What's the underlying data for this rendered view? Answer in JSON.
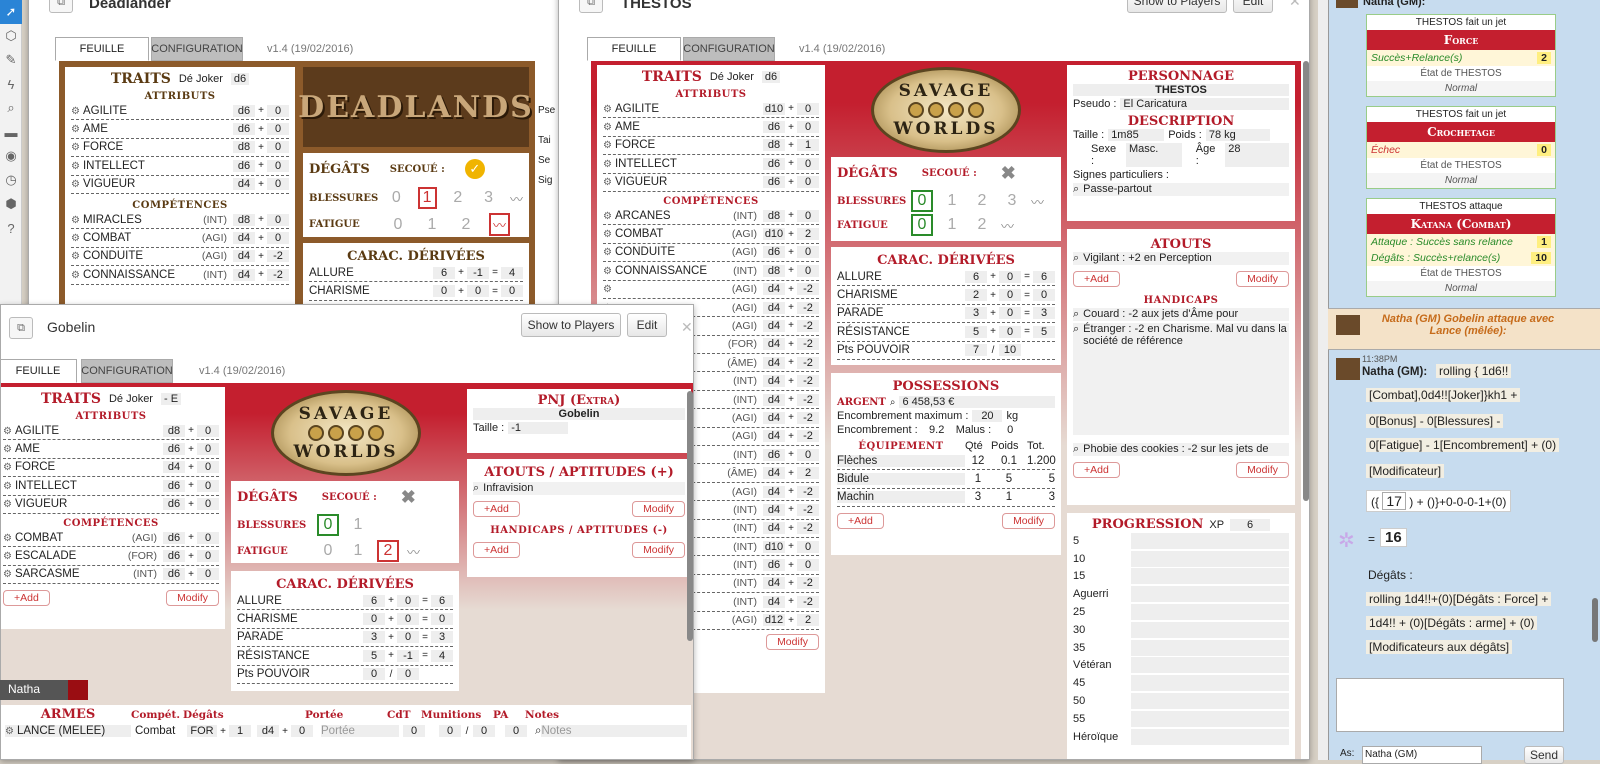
{
  "toolbar": {
    "icons": [
      "select-icon",
      "cube-icon",
      "brush-icon",
      "lightning-icon",
      "zoom-icon",
      "ruler-icon",
      "eye-icon",
      "clock-icon",
      "dice-icon",
      "help-icon"
    ]
  },
  "deadlands": {
    "title": "Deadlander",
    "tab1": "FEUILLE",
    "tab2": "CONFIGURATION",
    "version": "v1.4 (19/02/2016)",
    "logo": "DEADLANDS",
    "traits": "TRAITS",
    "joker_label": "Dé Joker",
    "joker": "d6",
    "attrs_h": "ATTRIBUTS",
    "attrs": [
      {
        "n": "AGILITÉ",
        "d": "d6",
        "m": "0"
      },
      {
        "n": "ÂME",
        "d": "d6",
        "m": "0"
      },
      {
        "n": "FORCE",
        "d": "d8",
        "m": "0"
      },
      {
        "n": "INTELLECT",
        "d": "d6",
        "m": "0"
      },
      {
        "n": "VIGUEUR",
        "d": "d4",
        "m": "0"
      }
    ],
    "comp_h": "COMPÉTENCES",
    "comps": [
      {
        "n": "MIRACLES",
        "t": "(INT)",
        "d": "d8",
        "m": "0"
      },
      {
        "n": "COMBAT",
        "t": "(AGI)",
        "d": "d4",
        "m": "0"
      },
      {
        "n": "CONDUITE",
        "t": "(AGI)",
        "d": "d4",
        "m": "-2"
      },
      {
        "n": "CONNAISSANCE",
        "t": "(INT)",
        "d": "d4",
        "m": "-2"
      }
    ],
    "degats": "DÉGÂTS",
    "secoue": "SECOUÉ :",
    "blessures": "BLESSURES",
    "fatigue": "FATIGUE",
    "bl": [
      "0",
      "1",
      "2",
      "3"
    ],
    "fa": [
      "0",
      "1",
      "2"
    ],
    "carac_h": "CARAC. DÉRIVÉES",
    "c1": {
      "n": "ALLURE",
      "a": "6",
      "b": "-1",
      "r": "4"
    },
    "c2": {
      "n": "CHARISME",
      "a": "0",
      "b": "0",
      "r": "0"
    },
    "side": [
      "Pse",
      "Tai",
      "Se",
      "Sig"
    ]
  },
  "thestos": {
    "title": "THESTOS",
    "show": "Show to Players",
    "edit": "Edit",
    "tab1": "FEUILLE",
    "tab2": "CONFIGURATION",
    "version": "v1.4 (19/02/2016)",
    "traits": "TRAITS",
    "joker_label": "Dé Joker",
    "joker": "d6",
    "attrs_h": "ATTRIBUTS",
    "attrs": [
      {
        "n": "AGILITÉ",
        "d": "d10",
        "m": "0"
      },
      {
        "n": "ÂME",
        "d": "d6",
        "m": "0"
      },
      {
        "n": "FORCE",
        "d": "d8",
        "m": "1"
      },
      {
        "n": "INTELLECT",
        "d": "d6",
        "m": "0"
      },
      {
        "n": "VIGUEUR",
        "d": "d6",
        "m": "0"
      }
    ],
    "comp_h": "COMPÉTENCES",
    "comps": [
      {
        "n": "ARCANES",
        "t": "(INT)",
        "d": "d8",
        "m": "0"
      },
      {
        "n": "COMBAT",
        "t": "(AGI)",
        "d": "d10",
        "m": "2"
      },
      {
        "n": "CONDUITE",
        "t": "(AGI)",
        "d": "d6",
        "m": "0"
      },
      {
        "n": "CONNAISSANCE",
        "t": "(INT)",
        "d": "d8",
        "m": "0"
      },
      {
        "n": "",
        "t": "(AGI)",
        "d": "d4",
        "m": "-2"
      },
      {
        "n": "",
        "t": "(AGI)",
        "d": "d4",
        "m": "-2"
      },
      {
        "n": "",
        "t": "(AGI)",
        "d": "d4",
        "m": "-2"
      },
      {
        "n": "",
        "t": "(FOR)",
        "d": "d4",
        "m": "-2"
      },
      {
        "n": "",
        "t": "(ÂME)",
        "d": "d4",
        "m": "-2"
      },
      {
        "n": "",
        "t": "(INT)",
        "d": "d4",
        "m": "-2"
      },
      {
        "n": "",
        "t": "(INT)",
        "d": "d4",
        "m": "-2"
      },
      {
        "n": "",
        "t": "(AGI)",
        "d": "d4",
        "m": "-2"
      },
      {
        "n": "",
        "t": "(AGI)",
        "d": "d4",
        "m": "-2"
      },
      {
        "n": "",
        "t": "(INT)",
        "d": "d6",
        "m": "0"
      },
      {
        "n": "",
        "t": "(ÂME)",
        "d": "d4",
        "m": "2"
      },
      {
        "n": "",
        "t": "(AGI)",
        "d": "d4",
        "m": "-2"
      },
      {
        "n": "",
        "t": "(INT)",
        "d": "d4",
        "m": "-2"
      },
      {
        "n": "",
        "t": "(INT)",
        "d": "d4",
        "m": "-2"
      },
      {
        "n": "",
        "t": "(INT)",
        "d": "d10",
        "m": "0"
      },
      {
        "n": "",
        "t": "(INT)",
        "d": "d6",
        "m": "0"
      },
      {
        "n": "",
        "t": "(INT)",
        "d": "d4",
        "m": "-2"
      },
      {
        "n": "",
        "t": "(INT)",
        "d": "d4",
        "m": "-2"
      },
      {
        "n": "",
        "t": "(AGI)",
        "d": "d12",
        "m": "2"
      }
    ],
    "modify": "Modify",
    "logo1": "SAVAGE",
    "logo2": "WORLDS",
    "degats": "DÉGÂTS",
    "secoue": "SECOUÉ :",
    "blessures": "BLESSURES",
    "fatigue": "FATIGUE",
    "bl": [
      "0",
      "1",
      "2",
      "3"
    ],
    "fa": [
      "0",
      "1",
      "2"
    ],
    "carac_h": "CARAC. DÉRIVÉES",
    "carac": [
      {
        "n": "ALLURE",
        "a": "6",
        "b": "0",
        "r": "6"
      },
      {
        "n": "CHARISME",
        "a": "2",
        "b": "0",
        "r": "0"
      },
      {
        "n": "PARADE",
        "a": "3",
        "b": "0",
        "r": "3"
      },
      {
        "n": "RÉSISTANCE",
        "a": "5",
        "b": "0",
        "r": "5"
      }
    ],
    "pouvoir": {
      "n": "Pts POUVOIR",
      "a": "7",
      "b": "10"
    },
    "poss_h": "POSSESSIONS",
    "argent_l": "ARGENT",
    "argent": "6 458,53 €",
    "encmax_l": "Encombrement maximum :",
    "encmax": "20",
    "kg": "kg",
    "enc_l": "Encombrement :",
    "enc": "9.2",
    "malus_l": "Malus :",
    "malus": "0",
    "equip_h": "ÉQUIPEMENT",
    "qte": "Qté",
    "poids": "Poids",
    "tot": "Tot.",
    "equip": [
      {
        "n": "Flèches",
        "q": "12",
        "p": "0.1",
        "t": "1.200"
      },
      {
        "n": "Bidule",
        "q": "1",
        "p": "5",
        "t": "5"
      },
      {
        "n": "Machin",
        "q": "3",
        "p": "1",
        "t": "3"
      }
    ],
    "add": "+Add",
    "perso_h": "PERSONNAGE",
    "name": "THESTOS",
    "pseudo_l": "Pseudo :",
    "pseudo": "El Caricatura",
    "desc_h": "DESCRIPTION",
    "taille_l": "Taille :",
    "taille": "1m85",
    "poids_l": "Poids :",
    "poidsv": "78 kg",
    "sexe_l": "Sexe :",
    "sexe": "Masc.",
    "age_l": "Âge :",
    "age": "28",
    "signes_l": "Signes particuliers :",
    "signes": "Passe-partout",
    "atouts_h": "ATOUTS",
    "atout1": "Vigilant : +2 en Perception",
    "handi_h": "HANDICAPS",
    "h1": "Couard : -2 aux jets d'Âme pour",
    "h2": "Étranger : -2 en Charisme. Mal vu dans la société de référence",
    "h3": "Phobie des cookies : -2 sur les jets de",
    "prog_h": "PROGRESSION",
    "xp_l": "XP",
    "xp": "6",
    "prog": [
      "5",
      "10",
      "15",
      "Aguerri",
      "25",
      "30",
      "35",
      "Vétéran",
      "45",
      "50",
      "55",
      "Héroïque"
    ]
  },
  "gobelin": {
    "title": "Gobelin",
    "show": "Show to Players",
    "edit": "Edit",
    "tab1": "FEUILLE",
    "tab2": "CONFIGURATION",
    "version": "v1.4 (19/02/2016)",
    "traits": "TRAITS",
    "joker_label": "Dé Joker",
    "joker": "- E",
    "attrs_h": "ATTRIBUTS",
    "attrs": [
      {
        "n": "AGILITÉ",
        "d": "d8",
        "m": "0"
      },
      {
        "n": "ÂME",
        "d": "d6",
        "m": "0"
      },
      {
        "n": "FORCE",
        "d": "d4",
        "m": "0"
      },
      {
        "n": "INTELLECT",
        "d": "d6",
        "m": "0"
      },
      {
        "n": "VIGUEUR",
        "d": "d6",
        "m": "0"
      }
    ],
    "comp_h": "COMPÉTENCES",
    "comps": [
      {
        "n": "COMBAT",
        "t": "(AGI)",
        "d": "d6",
        "m": "0"
      },
      {
        "n": "ESCALADE",
        "t": "(FOR)",
        "d": "d6",
        "m": "0"
      },
      {
        "n": "SARCASME",
        "t": "(INT)",
        "d": "d6",
        "m": "0"
      }
    ],
    "add": "+Add",
    "modify": "Modify",
    "logo1": "SAVAGE",
    "logo2": "WORLDS",
    "degats": "DÉGÂTS",
    "secoue": "SECOUÉ :",
    "blessures": "BLESSURES",
    "fatigue": "FATIGUE",
    "bl": [
      "0",
      "1"
    ],
    "fa": [
      "0",
      "1",
      "2"
    ],
    "carac_h": "CARAC. DÉRIVÉES",
    "carac": [
      {
        "n": "ALLURE",
        "a": "6",
        "b": "0",
        "r": "6"
      },
      {
        "n": "CHARISME",
        "a": "0",
        "b": "0",
        "r": "0"
      },
      {
        "n": "PARADE",
        "a": "3",
        "b": "0",
        "r": "3"
      },
      {
        "n": "RÉSISTANCE",
        "a": "5",
        "b": "-1",
        "r": "4"
      }
    ],
    "pouvoir": {
      "n": "Pts POUVOIR",
      "a": "0",
      "b": "0"
    },
    "pnj_h": "PNJ (Extra)",
    "name": "Gobelin",
    "taille_l": "Taille :",
    "taille": "-1",
    "atouts_h": "ATOUTS / APTITUDES (+)",
    "atout1": "Infravision",
    "handi_h": "HANDICAPS / APTITUDES (-)",
    "armes_h": "ARMES",
    "col_comp": "Compét.",
    "col_deg": "Dégâts",
    "col_portee": "Portée",
    "col_cdt": "CdT",
    "col_mun": "Munitions",
    "col_pa": "PA",
    "col_notes": "Notes",
    "arme": {
      "n": "LANCE (MÊLÉE)",
      "c": "Combat",
      "f": "FOR",
      "m1": "1",
      "d": "d4",
      "m2": "0",
      "portee": "Portée",
      "cdt": "0",
      "mun1": "0",
      "mun2": "0",
      "pa": "0",
      "notes": "Notes"
    }
  },
  "player_tag": "Natha",
  "chat": {
    "top": "Natha (GM):",
    "r1": {
      "a": "THESTOS fait un jet",
      "b": "Force",
      "c": "Succès+Relance(s)",
      "v": "2",
      "e": "État de THESTOS",
      "f": "Normal"
    },
    "r2": {
      "a": "THESTOS fait un jet",
      "b": "Crochetage",
      "c": "Échec",
      "v": "0",
      "e": "État de THESTOS",
      "f": "Normal"
    },
    "r3": {
      "a": "THESTOS attaque",
      "b": "Katana (Combat)",
      "c1": "Attaque : Succès sans relance",
      "v1": "1",
      "c2": "Dégâts : Succès+relance(s)",
      "v2": "10",
      "e": "État de THESTOS",
      "f": "Normal"
    },
    "emote": "Natha (GM) Gobelin attaque avec Lance (mêlée):",
    "time": "11:38PM",
    "who": "Natha (GM):",
    "l1": "rolling { 1d6!!",
    "l2": "[Combat],0d4!![Joker]}kh1 +",
    "l3": "0[Bonus] - 0[Blessures] -",
    "l4": "0[Fatigue] - 1[Encombrement] + (0)",
    "l5": "[Modificateur]",
    "f1": "({",
    "f2": "17",
    "f3": ") + ()}+0-0-0-1+(0)",
    "eq": "=",
    "res": "16",
    "deg": "Dégâts :",
    "l6": "rolling 1d4!!+(0)[Dégâts : Force] +",
    "l7": "1d4!! + (0)[Dégâts : arme] + (0)",
    "l8": "[Modificateurs aux dégâts]",
    "as_label": "As:",
    "as_value": "Natha (GM)",
    "send": "Send"
  }
}
